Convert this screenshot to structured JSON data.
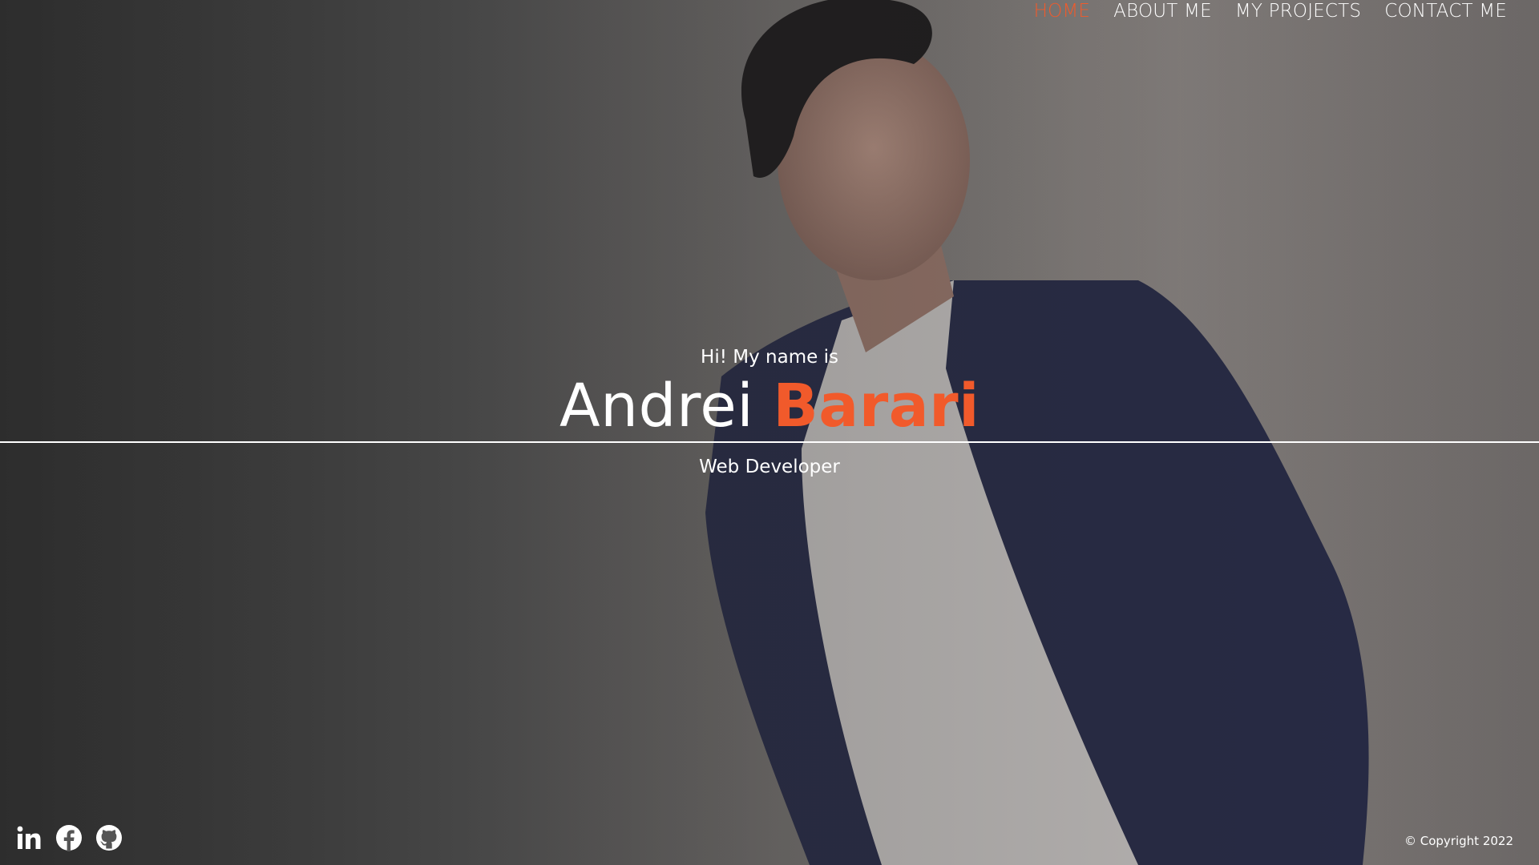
{
  "nav": {
    "items": [
      {
        "label": "HOME",
        "active": true
      },
      {
        "label": "ABOUT ME",
        "active": false
      },
      {
        "label": "MY PROJECTS",
        "active": false
      },
      {
        "label": "CONTACT ME",
        "active": false
      }
    ]
  },
  "hero": {
    "greeting": "Hi! My name is",
    "first_name": "Andrei",
    "last_name": "Barari",
    "role": "Web Developer"
  },
  "footer": {
    "social": [
      {
        "icon": "linkedin-icon"
      },
      {
        "icon": "facebook-icon"
      },
      {
        "icon": "github-icon"
      }
    ],
    "copyright": "© Copyright 2022"
  },
  "colors": {
    "accent": "#f15a2b",
    "text": "#ffffff",
    "background": "#5a5a5a"
  }
}
